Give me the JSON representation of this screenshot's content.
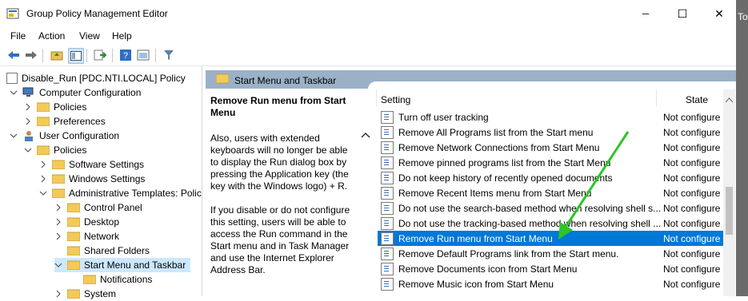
{
  "window": {
    "title": "Group Policy Management Editor",
    "controls": {
      "minimize": "─",
      "maximize": "☐",
      "close": "✕"
    },
    "right_edge_text": "To"
  },
  "menu": [
    "File",
    "Action",
    "View",
    "Help"
  ],
  "toolbar_icons": [
    "back-arrow-icon",
    "forward-arrow-icon",
    "up-folder-icon",
    "show-hide-tree-icon",
    "export-list-icon",
    "help-icon",
    "properties-icon",
    "filter-icon"
  ],
  "tree": {
    "root": "Disable_Run [PDC.NTI.LOCAL] Policy",
    "computer_config": "Computer Configuration",
    "cc_policies": "Policies",
    "cc_preferences": "Preferences",
    "user_config": "User Configuration",
    "uc_policies": "Policies",
    "software_settings": "Software Settings",
    "windows_settings": "Windows Settings",
    "admin_templates": "Administrative Templates: Polic",
    "control_panel": "Control Panel",
    "desktop": "Desktop",
    "network": "Network",
    "shared_folders": "Shared Folders",
    "start_menu": "Start Menu and Taskbar",
    "notifications": "Notifications",
    "system": "System"
  },
  "pane_header": "Start Menu and Taskbar",
  "description": {
    "title": "Remove Run menu from Start Menu",
    "body": "Also, users with extended keyboards will no longer be able to display the Run dialog box by pressing the Application key (the key with the Windows logo) + R.\n\nIf you disable or do not configure this setting, users will be able to access the Run command in the Start menu and in Task Manager and use the Internet Explorer Address Bar."
  },
  "columns": {
    "setting": "Setting",
    "state": "State"
  },
  "settings": [
    {
      "name": "Turn off user tracking",
      "state": "Not configure"
    },
    {
      "name": "Remove All Programs list from the Start menu",
      "state": "Not configure"
    },
    {
      "name": "Remove Network Connections from Start Menu",
      "state": "Not configure"
    },
    {
      "name": "Remove pinned programs list from the Start Menu",
      "state": "Not configure"
    },
    {
      "name": "Do not keep history of recently opened documents",
      "state": "Not configure"
    },
    {
      "name": "Remove Recent Items menu from Start Menu",
      "state": "Not configure"
    },
    {
      "name": "Do not use the search-based method when resolving shell s...",
      "state": "Not configure"
    },
    {
      "name": "Do not use the tracking-based method when resolving shell ...",
      "state": "Not configure"
    },
    {
      "name": "Remove Run menu from Start Menu",
      "state": "Not configure",
      "selected": true
    },
    {
      "name": "Remove Default Programs link from the Start menu.",
      "state": "Not configure"
    },
    {
      "name": "Remove Documents icon from Start Menu",
      "state": "Not configure"
    },
    {
      "name": "Remove Music icon from Start Menu",
      "state": "Not configure"
    }
  ],
  "colors": {
    "selection": "#0078d7",
    "header_band": "#9bb1c7",
    "arrow": "#2fc42a"
  }
}
